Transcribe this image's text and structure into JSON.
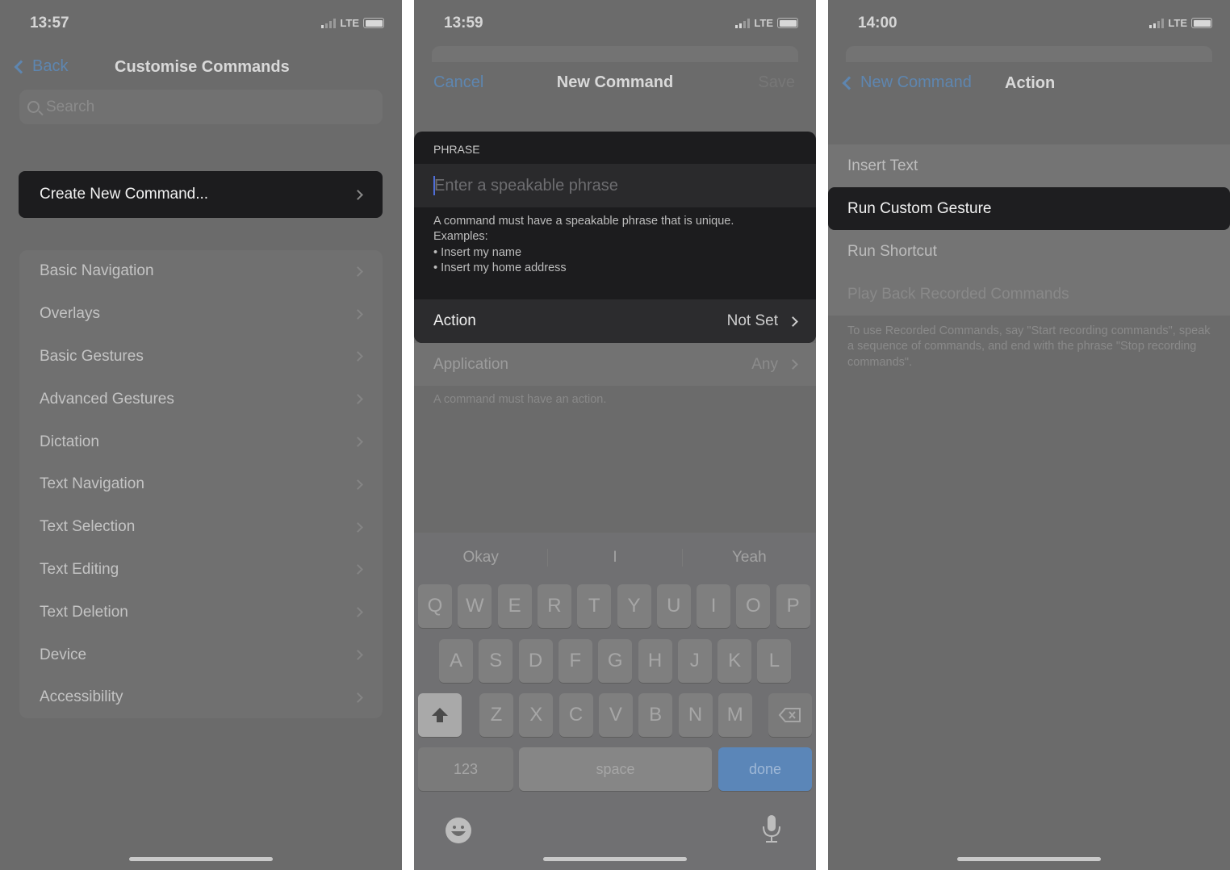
{
  "screens": [
    {
      "time": "13:57",
      "network": "LTE",
      "nav": {
        "back": "Back",
        "title": "Customise Commands"
      },
      "search": {
        "placeholder": "Search"
      },
      "create_button": "Create New Command...",
      "categories": [
        "Basic Navigation",
        "Overlays",
        "Basic Gestures",
        "Advanced Gestures",
        "Dictation",
        "Text Navigation",
        "Text Selection",
        "Text Editing",
        "Text Deletion",
        "Device",
        "Accessibility"
      ]
    },
    {
      "time": "13:59",
      "network": "LTE",
      "nav": {
        "cancel": "Cancel",
        "title": "New Command",
        "save": "Save"
      },
      "phrase": {
        "header": "PHRASE",
        "placeholder": "Enter a speakable phrase",
        "description": [
          "A command must have a speakable phrase that is unique.",
          "Examples:",
          "• Insert my name",
          "• Insert my home address"
        ]
      },
      "action": {
        "label": "Action",
        "value": "Not Set"
      },
      "application": {
        "label": "Application",
        "value": "Any"
      },
      "footer": "A command must have an action.",
      "keyboard": {
        "suggestions": [
          "Okay",
          "I",
          "Yeah"
        ],
        "rows": [
          [
            "Q",
            "W",
            "E",
            "R",
            "T",
            "Y",
            "U",
            "I",
            "O",
            "P"
          ],
          [
            "A",
            "S",
            "D",
            "F",
            "G",
            "H",
            "J",
            "K",
            "L"
          ],
          [
            "Z",
            "X",
            "C",
            "V",
            "B",
            "N",
            "M"
          ]
        ],
        "numbers": "123",
        "space": "space",
        "done": "done"
      }
    },
    {
      "time": "14:00",
      "network": "LTE",
      "nav": {
        "back": "New Command",
        "title": "Action"
      },
      "options": [
        "Insert Text",
        "Run Custom Gesture",
        "Run Shortcut",
        "Play Back Recorded Commands"
      ],
      "selected": "Run Custom Gesture",
      "footer": "To use Recorded Commands, say \"Start recording commands\", speak a sequence of commands, and end with the phrase \"Stop recording commands\"."
    }
  ],
  "colors": {
    "accent": "#5e86b0",
    "done_key": "#5b86b8",
    "dark_cell": "#1c1c1e",
    "background": "#6b6b6b"
  }
}
